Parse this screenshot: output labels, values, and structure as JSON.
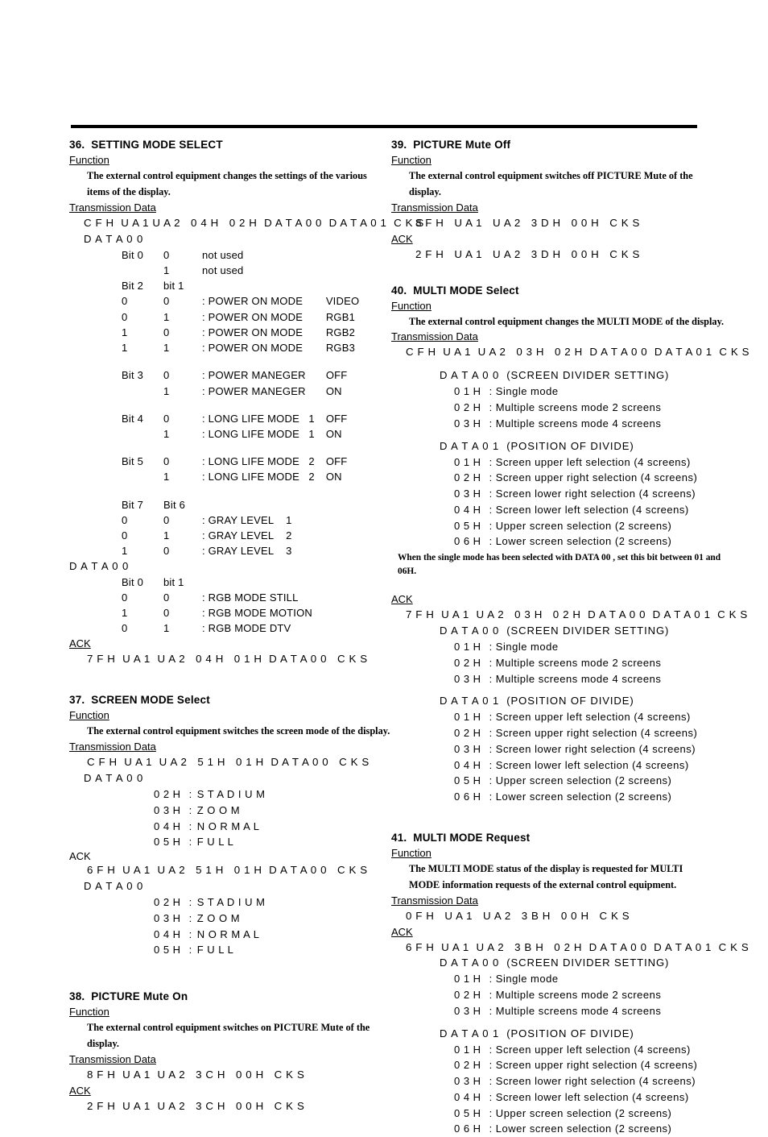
{
  "page": {
    "left_column_sections": [
      "36",
      "37",
      "38"
    ],
    "right_column_sections": [
      "39",
      "40",
      "41"
    ]
  },
  "labels": {
    "function": "Function",
    "transmission_data": "Transmission Data",
    "ack": "ACK",
    "data00": "D A T A 0 0",
    "data00_sp": "D A T A 0 0",
    "data00_divider": "D A T A 0 0  (SCREEN DIVIDER SETTING)",
    "data01_position": "D A T A 0 1  (POSITION OF DIVIDE)"
  },
  "sections": {
    "s36": {
      "title": "36.  SETTING MODE SELECT",
      "function_text": "The external control equipment changes the settings of the various items of the display.",
      "tx_hex": "C F H  U A 1 U A 2   0 4 H   0 2 H  D A T A 0 0  D A T A 0 1  C K S",
      "data00_label": "D A T A 0 0",
      "bits": [
        {
          "bit": "Bit 0",
          "val": "0",
          "desc": "not used",
          "extra": ""
        },
        {
          "bit": "",
          "val": "1",
          "desc": "not used",
          "extra": ""
        },
        {
          "bit": "Bit 2",
          "val": "bit 1",
          "desc": "",
          "extra": ""
        },
        {
          "bit": "0",
          "val": "0",
          "desc": ": POWER ON MODE",
          "extra": "VIDEO"
        },
        {
          "bit": "0",
          "val": "1",
          "desc": ": POWER ON MODE",
          "extra": "RGB1"
        },
        {
          "bit": "1",
          "val": "0",
          "desc": ": POWER ON MODE",
          "extra": "RGB2"
        },
        {
          "bit": "1",
          "val": "1",
          "desc": ": POWER ON MODE",
          "extra": "RGB3"
        },
        {
          "bit": "Bit 3",
          "val": "0",
          "desc": ": POWER MANEGER",
          "extra": "OFF",
          "gap_before": true
        },
        {
          "bit": "",
          "val": "1",
          "desc": ": POWER MANEGER",
          "extra": "ON"
        },
        {
          "bit": "Bit 4",
          "val": "0",
          "desc": ": LONG LIFE MODE   1",
          "extra": "OFF",
          "gap_before": true
        },
        {
          "bit": "",
          "val": "1",
          "desc": ": LONG LIFE MODE   1",
          "extra": "ON"
        },
        {
          "bit": "Bit 5",
          "val": "0",
          "desc": ": LONG LIFE MODE   2",
          "extra": "OFF",
          "gap_before": true
        },
        {
          "bit": "",
          "val": "1",
          "desc": ": LONG LIFE MODE   2",
          "extra": "ON"
        },
        {
          "bit": "Bit 7",
          "val": "Bit 6",
          "desc": "",
          "extra": "",
          "gap_before": true
        },
        {
          "bit": "0",
          "val": "0",
          "desc": ": GRAY LEVEL    1",
          "extra": ""
        },
        {
          "bit": "0",
          "val": "1",
          "desc": ": GRAY LEVEL    2",
          "extra": ""
        },
        {
          "bit": "1",
          "val": "0",
          "desc": ": GRAY LEVEL    3",
          "extra": ""
        }
      ],
      "data00_label_2": "D A T A 0 0",
      "bits2": [
        {
          "bit": "Bit 0",
          "val": "bit 1",
          "desc": "",
          "extra": ""
        },
        {
          "bit": "0",
          "val": "0",
          "desc": ": RGB MODE STILL",
          "extra": ""
        },
        {
          "bit": "1",
          "val": "0",
          "desc": ": RGB MODE MOTION",
          "extra": ""
        },
        {
          "bit": "0",
          "val": "1",
          "desc": ": RGB MODE DTV",
          "extra": ""
        }
      ],
      "ack_hex": "7 F H  U A 1  U A 2   0 4 H   0 1 H  D A T A 0 0   C K S"
    },
    "s37": {
      "title": "37.  SCREEN MODE Select",
      "function_text": "The external control equipment switches the screen mode of the display.",
      "tx_hex": "C F H  U A 1  U A 2   5 1 H   0 1 H  D A T A 0 0   C K S",
      "tx_data00_label": "D A T A 0 0",
      "tx_modes": [
        {
          "code": "0 2 H",
          "sep": ":",
          "name": "S T A D I U M"
        },
        {
          "code": "0 3 H",
          "sep": ":",
          "name": "Z O O M"
        },
        {
          "code": "0 4 H",
          "sep": ":",
          "name": "N O R M A L"
        },
        {
          "code": "0 5 H",
          "sep": ":",
          "name": "F U L L"
        }
      ],
      "ack_hex": "6 F H  U A 1  U A 2   5 1 H   0 1 H  D A T A 0 0   C K S",
      "ack_data00_label": "D A T A 0 0",
      "ack_modes": [
        {
          "code": "0 2 H",
          "sep": ":",
          "name": "S T A D I U M"
        },
        {
          "code": "0 3 H",
          "sep": ":",
          "name": "Z O O M"
        },
        {
          "code": "0 4 H",
          "sep": ":",
          "name": "N O R M A L"
        },
        {
          "code": "0 5 H",
          "sep": ":",
          "name": "F U L L"
        }
      ]
    },
    "s38": {
      "title": "38.  PICTURE Mute On",
      "function_text": "The external control equipment switches on PICTURE Mute of the display.",
      "tx_hex": "8 F H  U A 1  U A 2   3 C H   0 0 H   C K S",
      "ack_hex": "2 F H  U A 1  U A 2   3 C H   0 0 H   C K S"
    },
    "s39": {
      "title": "39.  PICTURE Mute Off",
      "function_text": "The external control equipment switches off PICTURE Mute of the display.",
      "tx_hex": "8 F H   U A 1   U A 2   3 D H   0 0 H   C K S",
      "ack_hex": "2 F H   U A 1   U A 2   3 D H   0 0 H   C K S"
    },
    "s40": {
      "title": "40.  MULTI MODE Select",
      "function_text": "The external control equipment changes the MULTI MODE of the display.",
      "tx_hex": "C F H  U A 1  U A 2   0 3 H   0 2 H  D A T A 0 0  D A T A 0 1  C K S",
      "tx_divider_label": "D A T A 0 0  (SCREEN DIVIDER SETTING)",
      "tx_divider_items": [
        {
          "code": "0 1 H",
          "desc": ": Single mode"
        },
        {
          "code": "0 2 H",
          "desc": ": Multiple screens mode 2 screens"
        },
        {
          "code": "0 3 H",
          "desc": ": Multiple screens mode 4 screens"
        }
      ],
      "tx_position_label": "D A T A 0 1  (POSITION OF DIVIDE)",
      "tx_position_items": [
        {
          "code": "0 1 H",
          "desc": ": Screen upper left selection (4 screens)"
        },
        {
          "code": "0 2 H",
          "desc": ": Screen upper right selection (4 screens)"
        },
        {
          "code": "0 3 H",
          "desc": ": Screen lower right selection (4 screens)"
        },
        {
          "code": "0 4 H",
          "desc": ": Screen lower left selection (4 screens)"
        },
        {
          "code": "0 5 H",
          "desc": ": Upper screen selection (2 screens)"
        },
        {
          "code": "0 6 H",
          "desc": ": Lower screen selection (2 screens)"
        }
      ],
      "note": "When the single mode has been selected with DATA 00 , set this bit between 01 and 06H.",
      "ack_hex": "7 F H  U A 1  U A 2   0 3 H   0 2 H  D A T A 0 0  D A T A 0 1  C K S",
      "ack_divider_label": "D A T A 0 0  (SCREEN DIVIDER SETTING)",
      "ack_divider_items": [
        {
          "code": "0 1 H",
          "desc": ": Single mode"
        },
        {
          "code": "0 2 H",
          "desc": ": Multiple screens mode 2 screens"
        },
        {
          "code": "0 3 H",
          "desc": ": Multiple screens mode 4 screens"
        }
      ],
      "ack_position_label": "D A T A 0 1  (POSITION OF DIVIDE)",
      "ack_position_items": [
        {
          "code": "0 1 H",
          "desc": ": Screen upper left selection (4 screens)"
        },
        {
          "code": "0 2 H",
          "desc": ": Screen upper right selection (4 screens)"
        },
        {
          "code": "0 3 H",
          "desc": ": Screen lower right selection (4 screens)"
        },
        {
          "code": "0 4 H",
          "desc": ": Screen lower left selection (4 screens)"
        },
        {
          "code": "0 5 H",
          "desc": ": Upper screen selection (2 screens)"
        },
        {
          "code": "0 6 H",
          "desc": ": Lower screen selection (2 screens)"
        }
      ]
    },
    "s41": {
      "title": "41.  MULTI MODE Request",
      "function_text": "The MULTI MODE status of the display is requested for MULTI MODE information requests of the external control equipment.",
      "tx_hex": "0 F H   U A 1   U A 2   3 B H   0 0 H   C K S",
      "ack_hex": "6 F H  U A 1  U A 2   3 B H   0 2 H  D A T A 0 0  D A T A 0 1  C K S",
      "ack_divider_label": "D A T A 0 0  (SCREEN DIVIDER SETTING)",
      "ack_divider_items": [
        {
          "code": "0 1 H",
          "desc": ": Single mode"
        },
        {
          "code": "0 2 H",
          "desc": ": Multiple screens mode 2 screens"
        },
        {
          "code": "0 3 H",
          "desc": ": Multiple screens mode 4 screens"
        }
      ],
      "ack_position_label": "D A T A 0 1  (POSITION OF DIVIDE)",
      "ack_position_items": [
        {
          "code": "0 1 H",
          "desc": ": Screen upper left selection (4 screens)"
        },
        {
          "code": "0 2 H",
          "desc": ": Screen upper right selection (4 screens)"
        },
        {
          "code": "0 3 H",
          "desc": ": Screen lower right selection (4 screens)"
        },
        {
          "code": "0 4 H",
          "desc": ": Screen lower left selection (4 screens)"
        },
        {
          "code": "0 5 H",
          "desc": ": Upper screen selection (2 screens)"
        },
        {
          "code": "0 6 H",
          "desc": ": Lower screen selection (2 screens)"
        }
      ]
    }
  }
}
